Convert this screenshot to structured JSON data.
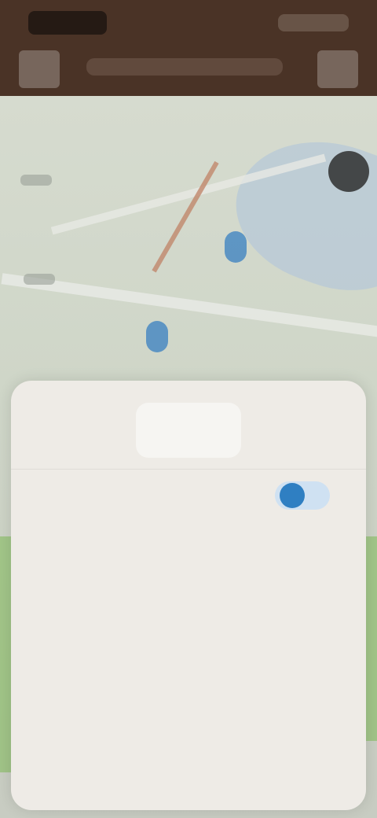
{
  "app": {
    "title": "",
    "status_time": "",
    "status_icons": ""
  },
  "topbar": {
    "menu_icon": "menu-icon",
    "action_icon": "more-icon"
  },
  "map": {
    "labels": [
      "",
      ""
    ]
  },
  "sheet": {
    "tabs": [
      {
        "label": "",
        "active": false
      },
      {
        "label": "",
        "active": true
      },
      {
        "label": "",
        "active": false
      }
    ],
    "rows": [
      {
        "title": "",
        "subtitle": "",
        "toggle": true
      },
      {
        "title": "",
        "subtitle": ""
      },
      {
        "title": "",
        "subtitle": ""
      },
      {
        "title": "",
        "subtitle": ""
      },
      {
        "title": "",
        "subtitle": ""
      }
    ]
  },
  "colors": {
    "topbar": "#4a3326",
    "sheet": "#eeebe6",
    "accent": "#2f7fc2"
  }
}
